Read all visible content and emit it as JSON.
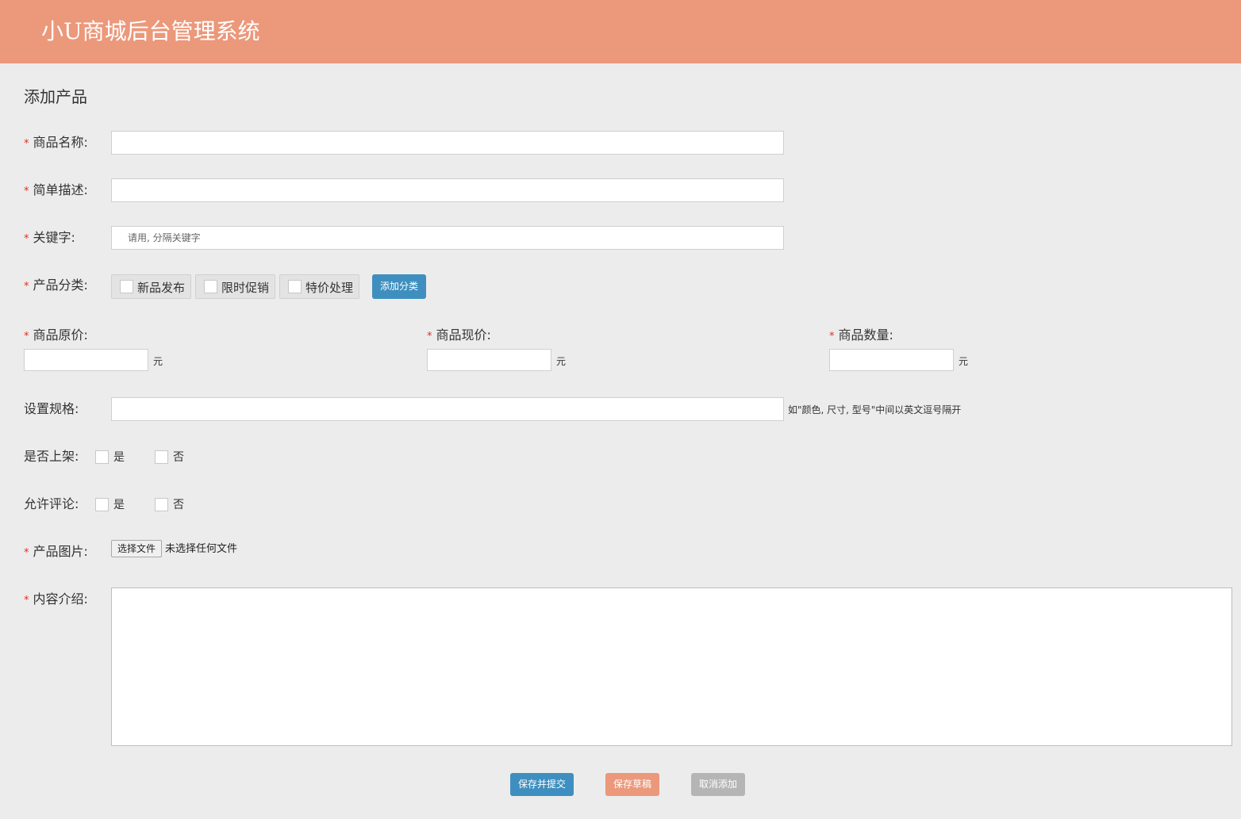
{
  "header": {
    "title": "小U商城后台管理系统"
  },
  "page_title": "添加产品",
  "required_mark": "*",
  "fields": {
    "name_label": "商品名称:",
    "desc_label": "简单描述:",
    "keyword_label": "关键字:",
    "keyword_placeholder": "请用, 分隔关键字",
    "category_label": "产品分类:",
    "categories": [
      "新品发布",
      "限时促销",
      "特价处理"
    ],
    "add_category_button": "添加分类",
    "original_price_label": "商品原价:",
    "current_price_label": "商品现价:",
    "quantity_label": "商品数量:",
    "unit": "元",
    "spec_label": "设置规格:",
    "spec_hint": "如\"颜色, 尺寸, 型号\"中间以英文逗号隔开",
    "listed_label": "是否上架:",
    "comments_label": "允许评论:",
    "yes": "是",
    "no": "否",
    "image_label": "产品图片:",
    "file_button": "选择文件",
    "file_status": "未选择任何文件",
    "content_label": "内容介绍:"
  },
  "actions": {
    "save_submit": "保存并提交",
    "save_draft": "保存草稿",
    "cancel": "取消添加"
  },
  "colors": {
    "header_bg": "#eb987b",
    "primary_blue": "#3e8fbf",
    "draft_orange": "#eb987b",
    "cancel_gray": "#b5b5b5",
    "required_red": "#d9312a"
  }
}
